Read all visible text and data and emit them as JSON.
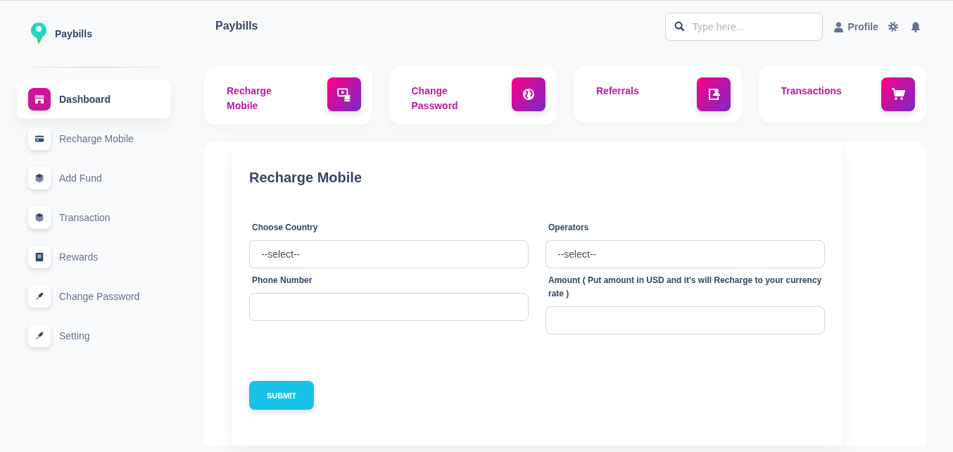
{
  "sidebar": {
    "brand": "Paybills",
    "items": [
      {
        "label": "Dashboard",
        "selected": true
      },
      {
        "label": "Recharge Mobile",
        "selected": false
      },
      {
        "label": "Add Fund",
        "selected": false
      },
      {
        "label": "Transaction",
        "selected": false
      },
      {
        "label": "Rewards",
        "selected": false
      },
      {
        "label": "Change Password",
        "selected": false
      },
      {
        "label": "Setting",
        "selected": false
      }
    ]
  },
  "topbar": {
    "title": "Paybills",
    "search": {
      "placeholder": "Type here..."
    },
    "profile": "Profile"
  },
  "quick_cards": [
    {
      "label": "Recharge Mobile"
    },
    {
      "label": "Change Password"
    },
    {
      "label": "Referrals"
    },
    {
      "label": "Transactions"
    }
  ],
  "form": {
    "title": "Recharge Mobile",
    "fields": [
      {
        "label": "Choose Country",
        "value": "--select--"
      },
      {
        "label": "Operators",
        "value": "--select--"
      },
      {
        "label": "Phone Number"
      },
      {
        "label": "Amount ( Put amount in USD and it's will Recharge to your currency rate )"
      }
    ],
    "submit": "SUBMIT"
  }
}
